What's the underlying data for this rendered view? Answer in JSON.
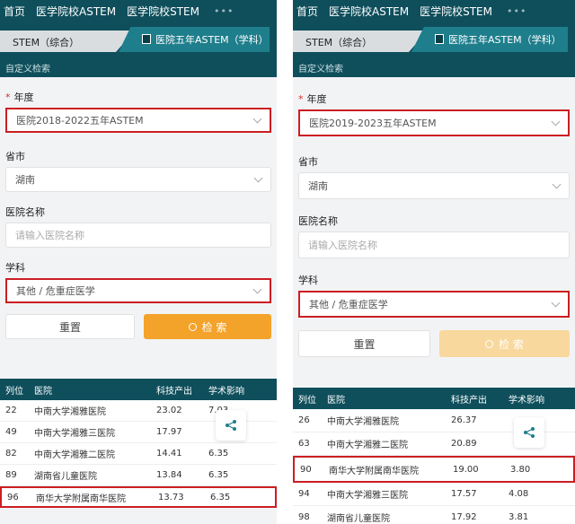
{
  "nav": {
    "items": [
      "首页",
      "医学院校ASTEM",
      "医学院校STEM"
    ],
    "more": "•••"
  },
  "tabs": {
    "left_comprehensive": "STEM（综合）",
    "right_hospital": "医院五年ASTEM（学科）"
  },
  "custom_search": "自定义检索",
  "form": {
    "year_label": "年度",
    "required_mark": "*",
    "province_label": "省市",
    "province_value": "湖南",
    "hospital_label": "医院名称",
    "hospital_placeholder": "请输入医院名称",
    "subject_label": "学科",
    "subject_value": "其他 / 危重症医学",
    "reset_label": "重置",
    "search_label": "检 索"
  },
  "left": {
    "year_value": "医院2018-2022五年ASTEM",
    "table": {
      "headers": [
        "列位",
        "医院",
        "科技产出",
        "学术影响"
      ],
      "rows": [
        [
          "22",
          "中南大学湘雅医院",
          "23.02",
          "7.03"
        ],
        [
          "49",
          "中南大学湘雅三医院",
          "17.97",
          ""
        ],
        [
          "82",
          "中南大学湘雅二医院",
          "14.41",
          "6.35"
        ],
        [
          "89",
          "湖南省儿童医院",
          "13.84",
          "6.35"
        ],
        [
          "96",
          "南华大学附属南华医院",
          "13.73",
          "6.35"
        ]
      ]
    }
  },
  "right": {
    "year_value": "医院2019-2023五年ASTEM",
    "table": {
      "headers": [
        "列位",
        "医院",
        "科技产出",
        "学术影响"
      ],
      "rows": [
        [
          "26",
          "中南大学湘雅医院",
          "26.37",
          ""
        ],
        [
          "63",
          "中南大学湘雅二医院",
          "20.89",
          ""
        ],
        [
          "90",
          "南华大学附属南华医院",
          "19.00",
          "3.80"
        ],
        [
          "94",
          "中南大学湘雅三医院",
          "17.57",
          "4.08"
        ],
        [
          "98",
          "湖南省儿童医院",
          "17.92",
          "3.81"
        ]
      ]
    }
  },
  "colors": {
    "header": "#0f4f5c",
    "tab_active": "#1f7e8c",
    "search_button": "#f3a32a",
    "highlight": "#cc1e22"
  },
  "icons": {
    "share": "share-icon",
    "dropdown": "chevron-down-icon",
    "search": "search-icon",
    "book": "book-icon"
  }
}
